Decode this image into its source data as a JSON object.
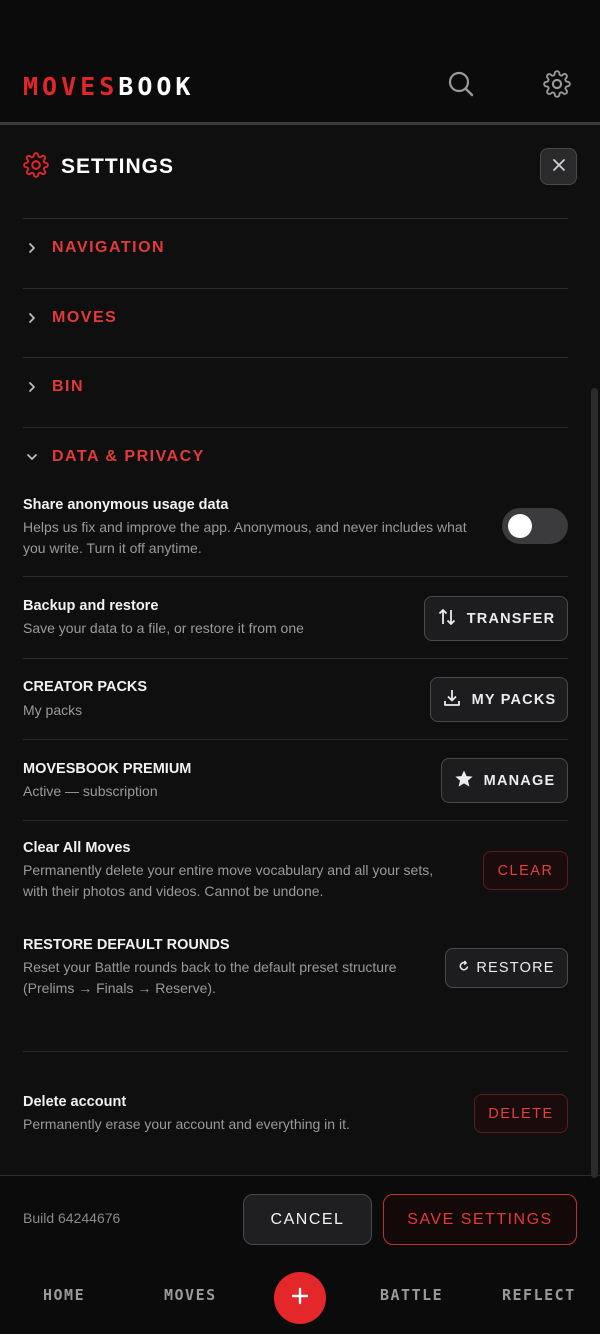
{
  "app": {
    "logo_red": "MOVES",
    "logo_white": "BOOK",
    "icons": [
      "search-icon",
      "gear-icon"
    ],
    "colors": {
      "accent": "#e0252b",
      "background": "#0b0b0c"
    }
  },
  "settings": {
    "title": "SETTINGS",
    "sections": [
      {
        "label": "NAVIGATION",
        "expanded": false
      },
      {
        "label": "MOVES",
        "expanded": false
      },
      {
        "label": "BIN",
        "expanded": false
      },
      {
        "label": "DATA & PRIVACY",
        "expanded": true
      }
    ],
    "usage": {
      "title": "Share anonymous usage data",
      "desc_line1": "Helps us fix and improve the app. Anonymous, and never includes what",
      "desc_line2": "you write. Turn it off anytime.",
      "enabled": false
    },
    "backup": {
      "title": "Backup and restore",
      "desc": "Save your data to a file, or restore it from one",
      "button": "TRANSFER"
    },
    "packs": {
      "title": "CREATOR PACKS",
      "desc": "My packs",
      "button": "MY PACKS"
    },
    "premium": {
      "title": "MOVESBOOK PREMIUM",
      "desc": "Active — subscription",
      "button": "MANAGE"
    },
    "clear": {
      "title": "Clear All Moves",
      "desc_line1": "Permanently delete your entire move vocabulary and all your sets,",
      "desc_line2": "with their photos and videos. Cannot be undone.",
      "button": "CLEAR"
    },
    "restore": {
      "title": "RESTORE DEFAULT ROUNDS",
      "desc_line1": "Reset your Battle rounds back to the default preset structure",
      "desc_line2": "(Prelims → Finals → Reserve).",
      "button": "RESTORE"
    },
    "delete_account": {
      "title": "Delete account",
      "desc": "Permanently erase your account and everything in it.",
      "button": "DELETE"
    }
  },
  "footer": {
    "build": "Build 64244676",
    "cancel": "CANCEL",
    "save": "SAVE SETTINGS"
  },
  "nav": {
    "home": "HOME",
    "moves": "MOVES",
    "battle": "BATTLE",
    "reflect": "REFLECT",
    "fab": "+"
  }
}
